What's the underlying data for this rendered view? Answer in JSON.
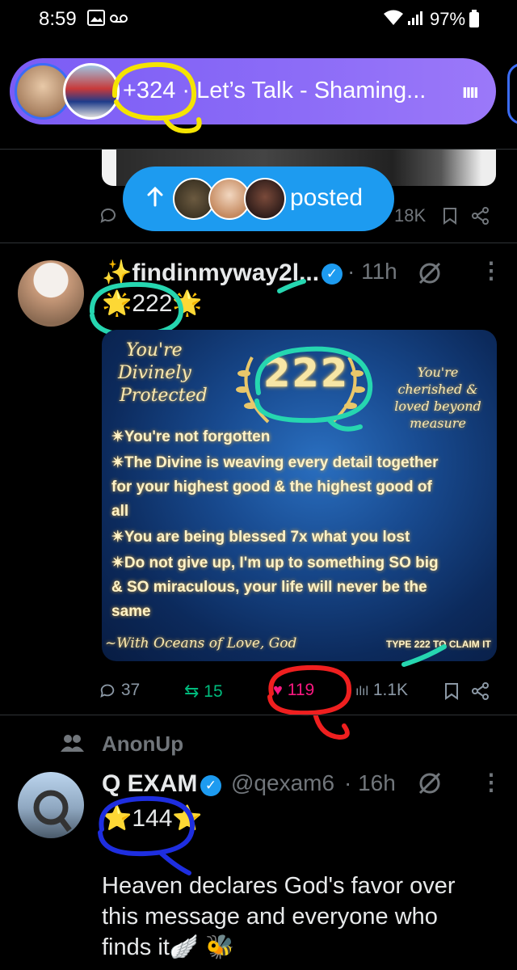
{
  "status_bar": {
    "time": "8:59",
    "battery": "97%"
  },
  "spaces": {
    "count": "+324 ·",
    "title": "Let’s Talk - Shaming..."
  },
  "prev_post": {
    "views": "18K"
  },
  "posted_banner": {
    "label": "posted"
  },
  "post1": {
    "display_name": "findinmyway2l...",
    "time": "· 11h",
    "text": "222",
    "card": {
      "left_script": [
        "You're",
        "Divinely",
        "Protected"
      ],
      "number": "222",
      "right_script": [
        "You're",
        "cherished &",
        "loved beyond",
        "measure"
      ],
      "lines": [
        "You're not forgotten",
        "The Divine is weaving every detail together",
        "for your highest good & the highest good of",
        "all",
        "You are being blessed 7x what you lost",
        "Do not give up, I'm up to something SO big",
        "& SO miraculous, your life will never be the",
        "same"
      ],
      "signature": "~With Oceans of Love, God",
      "claim": "TYPE 222 TO CLAIM IT"
    },
    "replies": "37",
    "reposts": "15",
    "likes": "119",
    "views": "1.1K"
  },
  "community": {
    "label": "AnonUp"
  },
  "post2": {
    "display_name": "Q EXAM",
    "handle": "@qexam6",
    "time": "· 16h",
    "number": "144",
    "text": "Heaven declares God's favor over this message and everyone who finds it"
  },
  "colors": {
    "accent": "#1d9bf0",
    "spaces": "#8c6cf7",
    "like": "#f91880",
    "repost": "#00ba7c"
  }
}
